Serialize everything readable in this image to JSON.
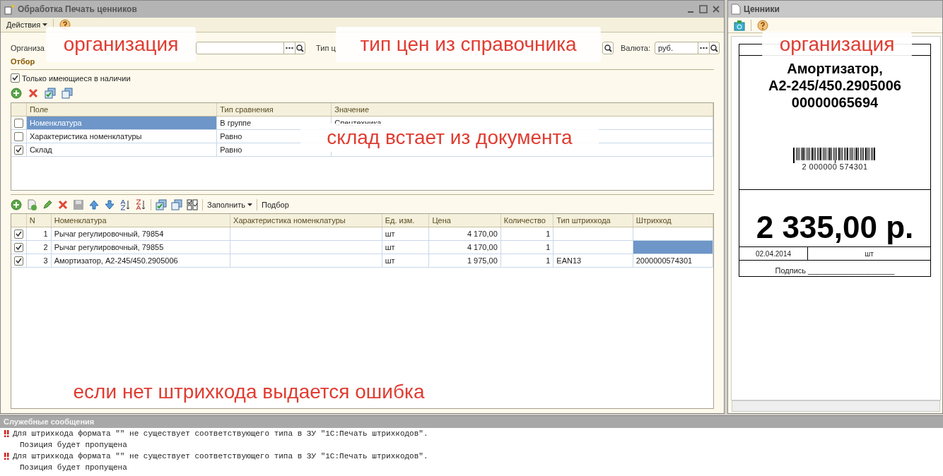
{
  "window": {
    "title": "Обработка  Печать ценников"
  },
  "menu": {
    "actions": "Действия"
  },
  "fields": [
    {
      "label": "Организа"
    },
    {
      "label": "Тип ц"
    },
    {
      "label": "Валюта:",
      "value": "руб."
    }
  ],
  "filter": {
    "title": "Отбор",
    "only_available": {
      "label": "Только имеющиеся в наличии",
      "checked": true
    },
    "columns": [
      "Поле",
      "Тип сравнения",
      "Значение"
    ],
    "rows": [
      {
        "checked": false,
        "selected": true,
        "field": "Номенклатура",
        "comparison": "В группе",
        "value": "Спецтехника"
      },
      {
        "checked": false,
        "selected": false,
        "field": "Характеристика номенклатуры",
        "comparison": "Равно"
      },
      {
        "checked": true,
        "selected": false,
        "field": "Склад",
        "comparison": "Равно"
      }
    ]
  },
  "items_toolbar": {
    "fill": "Заполнить",
    "pick": "Подбор"
  },
  "items": {
    "columns": [
      "N",
      "Номенклатура",
      "Характеристика номенклатуры",
      "Ед. изм.",
      "Цена",
      "Количество",
      "Тип штрихкода",
      "Штрихкод"
    ],
    "rows": [
      {
        "checked": true,
        "selected": false,
        "n": "1",
        "name": "Рычаг регулировочный, 79854",
        "unit": "шт",
        "price": "4 170,00",
        "qty": "1"
      },
      {
        "checked": true,
        "selected": true,
        "n": "2",
        "name": "Рычаг регулировочный, 79855",
        "unit": "шт",
        "price": "4 170,00",
        "qty": "1"
      },
      {
        "checked": true,
        "selected": false,
        "n": "3",
        "name": "Амортизатор, А2-245/450.2905006",
        "unit": "шт",
        "price": "1 975,00",
        "qty": "1",
        "barcode_type": "EAN13",
        "barcode": "2000000574301"
      }
    ]
  },
  "preview": {
    "title": "Ценники",
    "tag": {
      "name_lines": [
        "Амортизатор,",
        "А2-245/450.2905006",
        "00000065694"
      ],
      "barcode": "2 000000 574301",
      "price": "2 335,00 р.",
      "date": "02.04.2014",
      "unit": "шт",
      "signature": "Подпись ____________________"
    }
  },
  "messages": {
    "title": "Служебные сообщения",
    "items": [
      {
        "text": "Для штрихкода формата \"\" не существует соответствующего типа в ЗУ \"1С:Печать штрихкодов\".",
        "detail": "Позиция будет пропущена"
      },
      {
        "text": "Для штрихкода формата \"\" не существует соответствующего типа в ЗУ \"1С:Печать штрихкодов\".",
        "detail": "Позиция будет пропущена"
      }
    ]
  },
  "annotations": [
    "организация",
    "тип цен из справочника",
    "склад встает из документа",
    "если нет штрихкода выдается ошибка",
    "организация"
  ]
}
